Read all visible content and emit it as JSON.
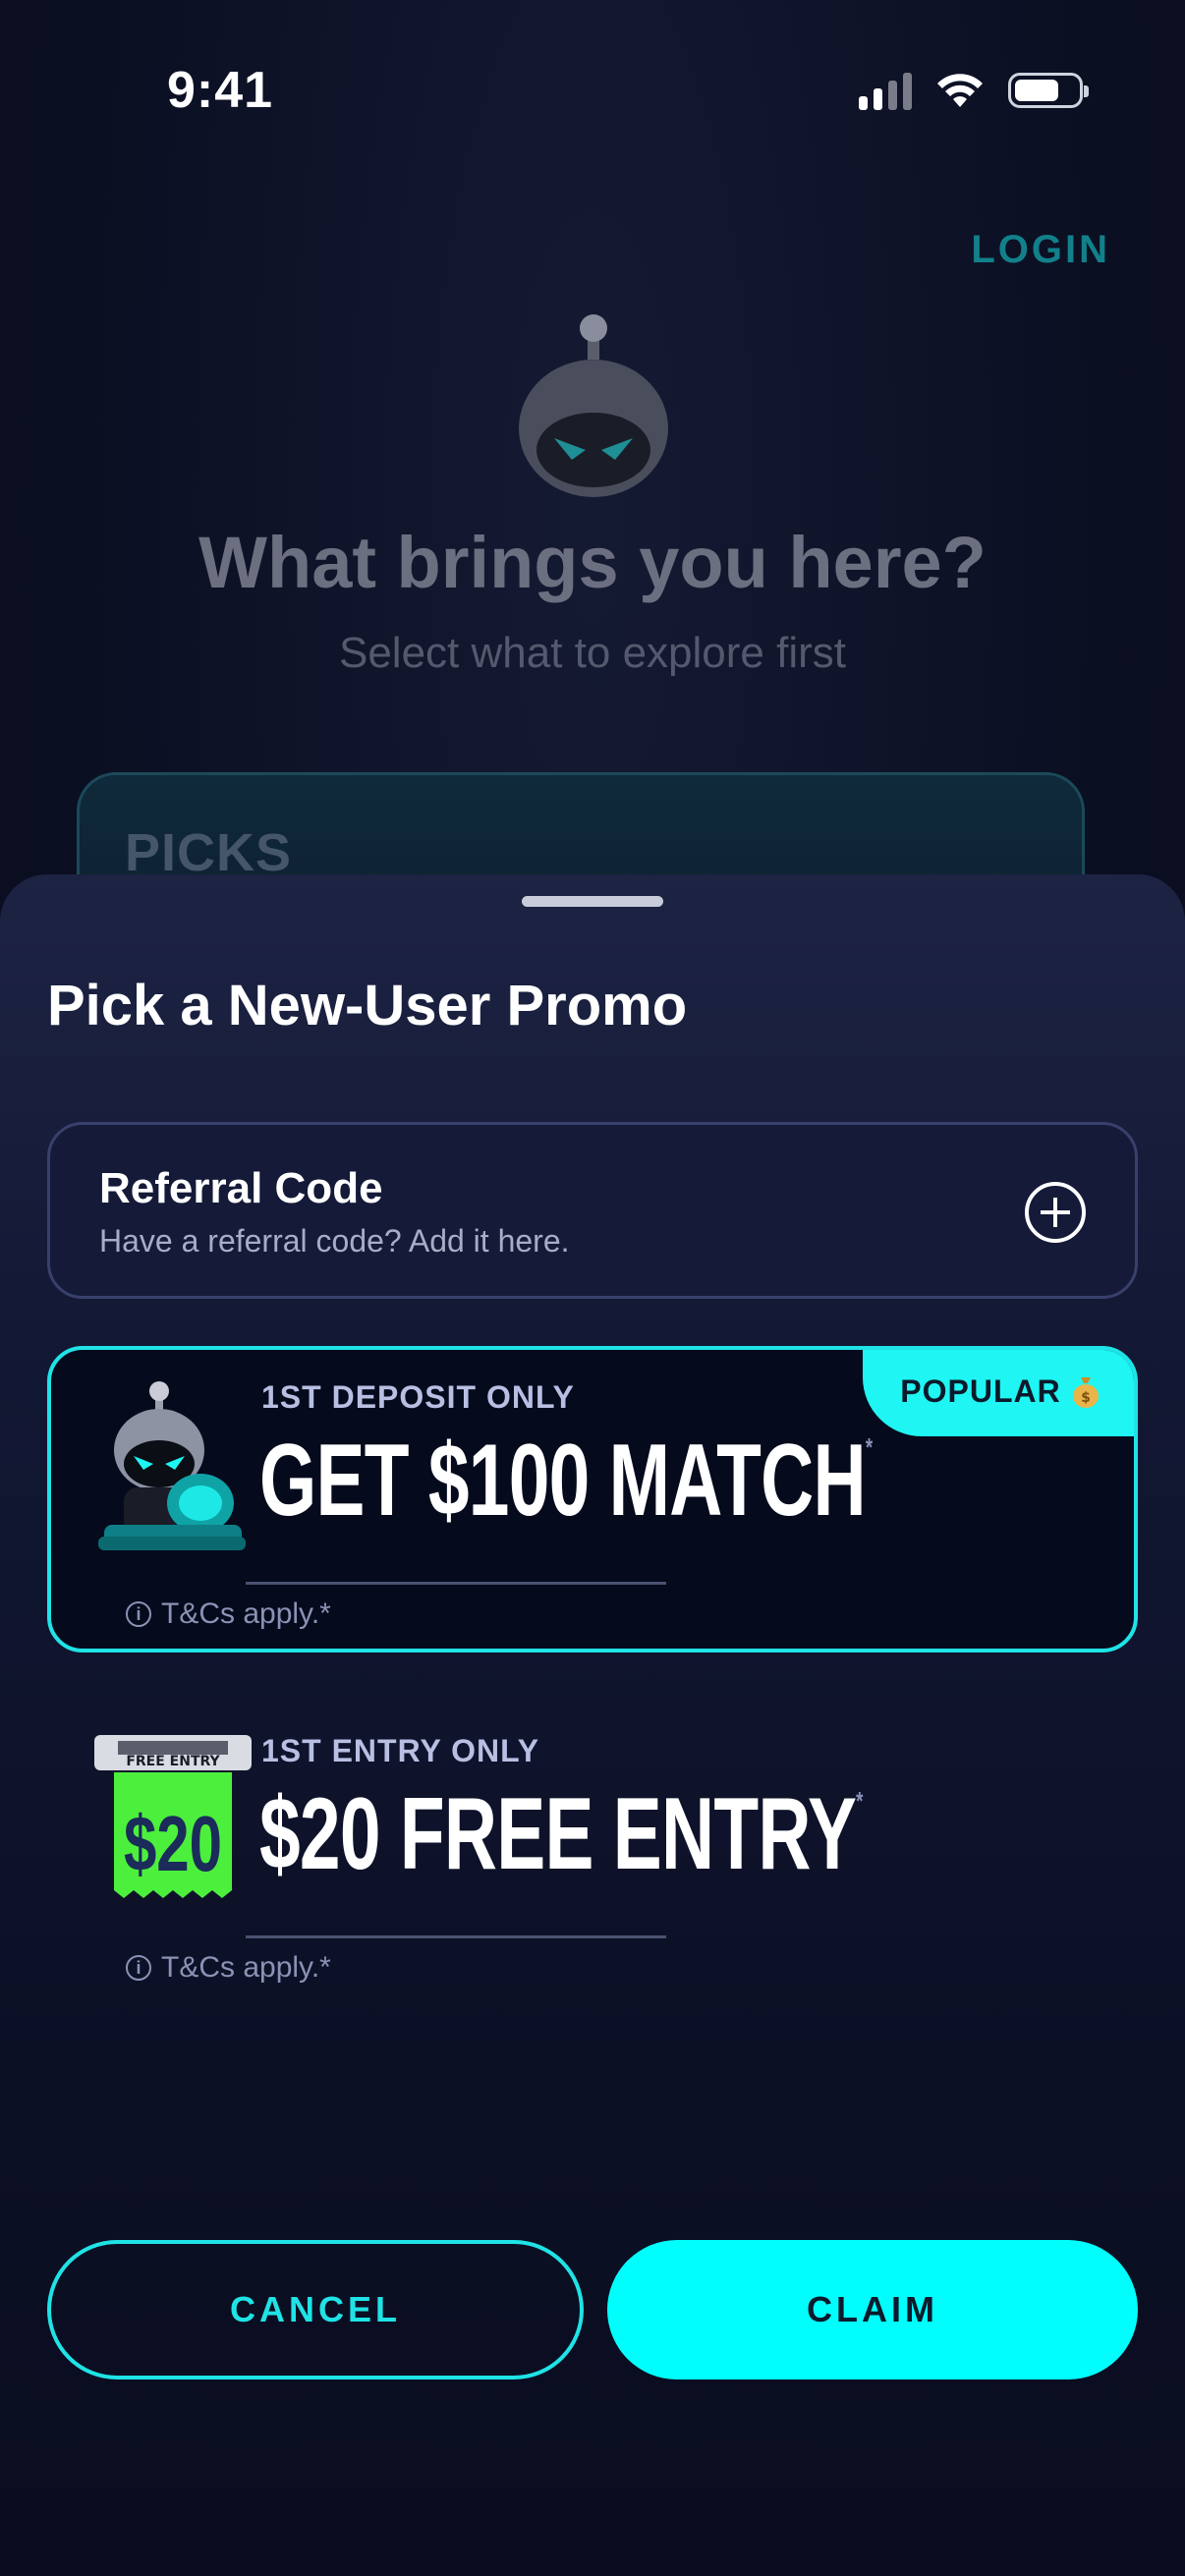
{
  "status_bar": {
    "time": "9:41"
  },
  "background": {
    "login_label": "LOGIN",
    "title": "What brings you here?",
    "subtitle": "Select what to explore first",
    "card_label": "PICKS"
  },
  "sheet": {
    "title": "Pick a New-User Promo",
    "referral": {
      "title": "Referral Code",
      "subtitle": "Have a referral code? Add it here."
    },
    "promos": [
      {
        "eyebrow": "1ST DEPOSIT ONLY",
        "headline": "GET $100 MATCH",
        "asterisk": "*",
        "terms": "T&Cs apply.*",
        "badge": "POPULAR",
        "selected": true,
        "icon": "robot-coins-icon"
      },
      {
        "eyebrow": "1ST ENTRY ONLY",
        "headline": "$20 FREE ENTRY",
        "asterisk": "*",
        "terms": "T&Cs apply.*",
        "ticket_top": "FREE ENTRY",
        "ticket_amount": "$20",
        "selected": false,
        "icon": "free-entry-ticket-icon"
      }
    ],
    "actions": {
      "cancel_label": "CANCEL",
      "claim_label": "CLAIM"
    }
  },
  "colors": {
    "accent": "#00fffc",
    "accent_border": "#1fe3e6",
    "background": "#0b0f22",
    "ticket_green": "#4cf03c"
  }
}
